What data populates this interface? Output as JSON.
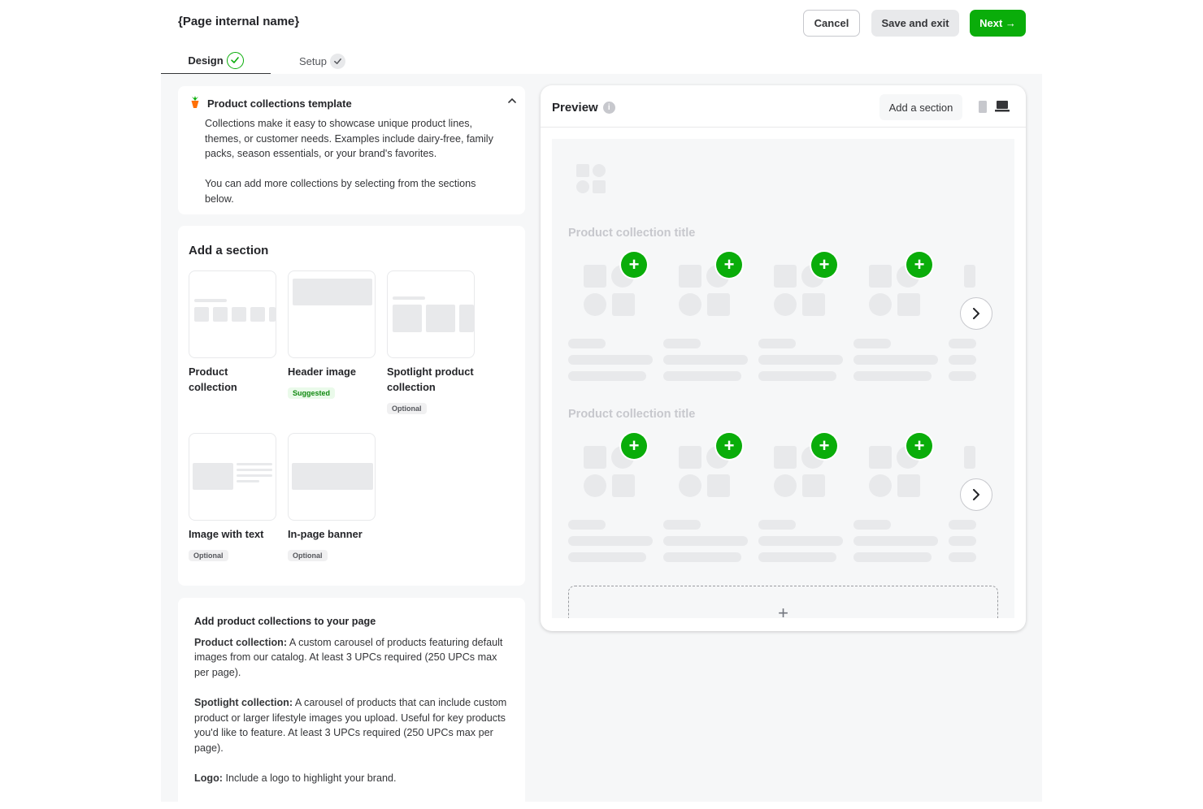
{
  "header": {
    "page_title": "{Page internal name}",
    "cancel_label": "Cancel",
    "save_exit_label": "Save and exit",
    "next_label": "Next →"
  },
  "tabs": [
    {
      "label": "Design",
      "status": "complete"
    },
    {
      "label": "Setup",
      "status": "pending"
    }
  ],
  "template_card": {
    "title": "Product collections template",
    "paragraph_1": "Collections make it easy to showcase unique product lines, themes, or customer needs. Examples include dairy-free, family packs, season essentials, or your brand's favorites.",
    "paragraph_2": "You can add more collections by selecting from the sections below.",
    "icon": "carrot-icon"
  },
  "add_section": {
    "title": "Add a section",
    "tiles": [
      {
        "label": "Product collection",
        "badge": ""
      },
      {
        "label": "Header image",
        "badge": "Suggested"
      },
      {
        "label": "Spotlight product collection",
        "badge": "Optional"
      },
      {
        "label": "Image with text",
        "badge": "Optional"
      },
      {
        "label": "In-page banner",
        "badge": "Optional"
      }
    ]
  },
  "info_card": {
    "title": "Add product collections to your page",
    "items": [
      {
        "term": "Product collection:",
        "text": " A custom carousel of products featuring default images from our catalog. At least 3 UPCs required (250 UPCs max per page)."
      },
      {
        "term": "Spotlight collection:",
        "text": " A carousel of products that can include custom product or larger lifestyle images you upload. Useful for key products you'd like to feature. At least 3 UPCs required (250 UPCs max per page)."
      },
      {
        "term": "Logo:",
        "text": " Include a logo to highlight your brand."
      }
    ]
  },
  "preview": {
    "title": "Preview",
    "add_section_label": "Add a section",
    "device_selected": "desktop",
    "sections": [
      {
        "title": "Product collection title"
      },
      {
        "title": "Product collection title"
      }
    ],
    "add_plus": "+"
  },
  "colors": {
    "brand_green": "#0aad0a",
    "placeholder_grey": "#e8e9eb",
    "canvas_bg": "#f6f7f8"
  }
}
